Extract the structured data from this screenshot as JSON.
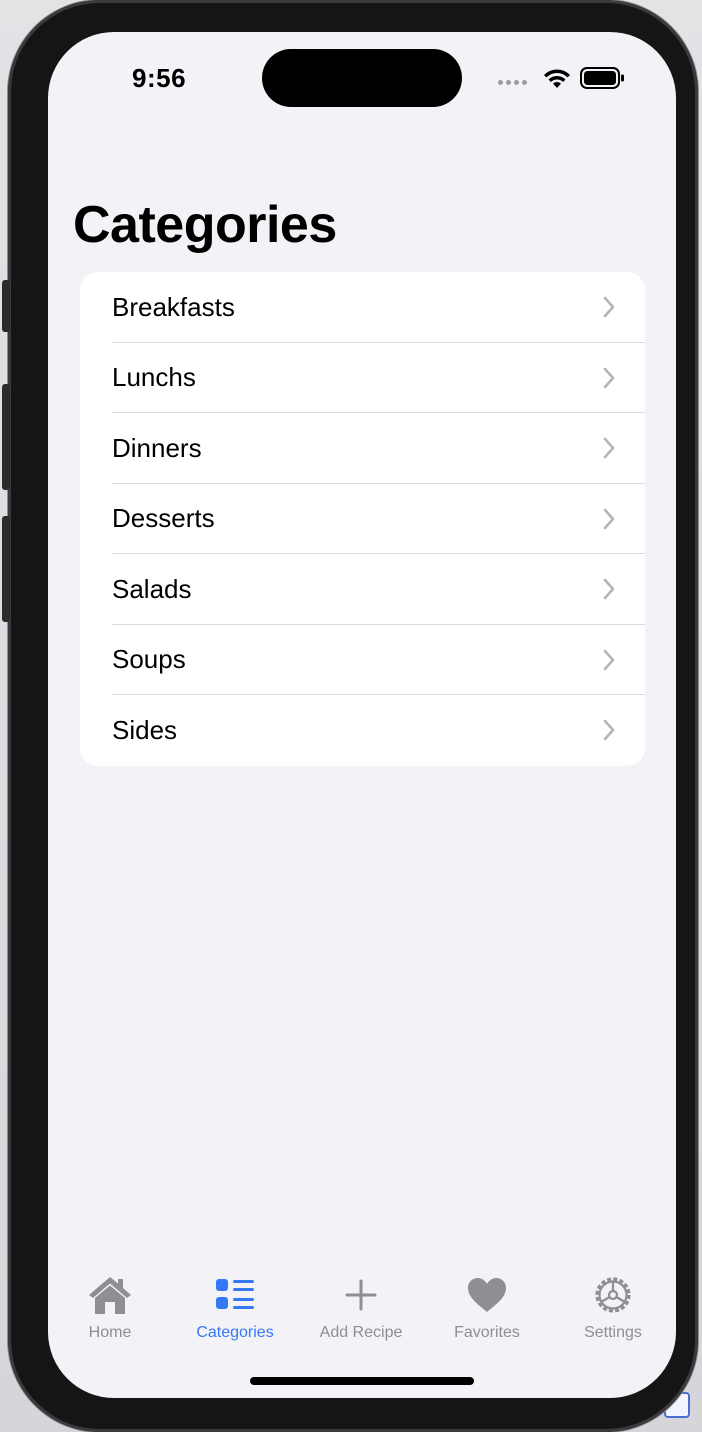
{
  "status_bar": {
    "time": "9:56"
  },
  "page": {
    "title": "Categories"
  },
  "categories": [
    {
      "label": "Breakfasts"
    },
    {
      "label": "Lunchs"
    },
    {
      "label": "Dinners"
    },
    {
      "label": "Desserts"
    },
    {
      "label": "Salads"
    },
    {
      "label": "Soups"
    },
    {
      "label": "Sides"
    }
  ],
  "tab_bar": {
    "tabs": [
      {
        "label": "Home",
        "icon": "house-icon",
        "active": false
      },
      {
        "label": "Categories",
        "icon": "list-icon",
        "active": true
      },
      {
        "label": "Add Recipe",
        "icon": "plus-icon",
        "active": false
      },
      {
        "label": "Favorites",
        "icon": "heart-icon",
        "active": false
      },
      {
        "label": "Settings",
        "icon": "gear-icon",
        "active": false
      }
    ]
  },
  "colors": {
    "accent": "#3478f6",
    "inactive": "#8e8e93",
    "background": "#f2f2f7"
  }
}
